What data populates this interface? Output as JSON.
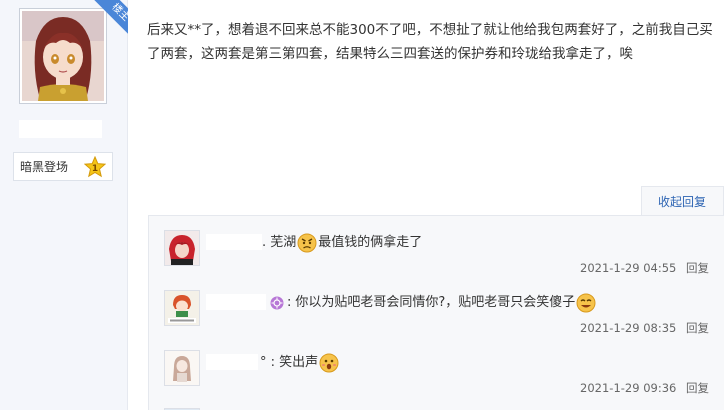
{
  "author": {
    "badge": "楼主",
    "level_name": "暗黑登场",
    "level_number": "1"
  },
  "post": {
    "content": "后来又**了，想着退不回来总不能300不了吧，不想扯了就让他给我包两套好了，之前我自己买了两套，这两套是第三第四套，结果特么三四套送的保护券和玲珑给我拿走了，唉"
  },
  "reply_section": {
    "toggle_label": "收起回复",
    "replies": [
      {
        "name_suffix": ". 芜湖",
        "emoji_before": "angry-face-emoji",
        "text": "最值钱的俩拿走了",
        "emoji_after": "",
        "time": "2021-1-29 04:55",
        "reply_label": "回复"
      },
      {
        "name_suffix": ":",
        "vip_icon": "vip-icon",
        "text": "你以为贴吧老哥会同情你?，贴吧老哥只会笑傻子",
        "emoji_after": "laughing-face-emoji",
        "time": "2021-1-29 08:35",
        "reply_label": "回复"
      },
      {
        "name_suffix": "° : 笑出声",
        "text": "",
        "emoji_after": "shocked-face-emoji",
        "time": "2021-1-29 09:36",
        "reply_label": "回复"
      }
    ]
  }
}
